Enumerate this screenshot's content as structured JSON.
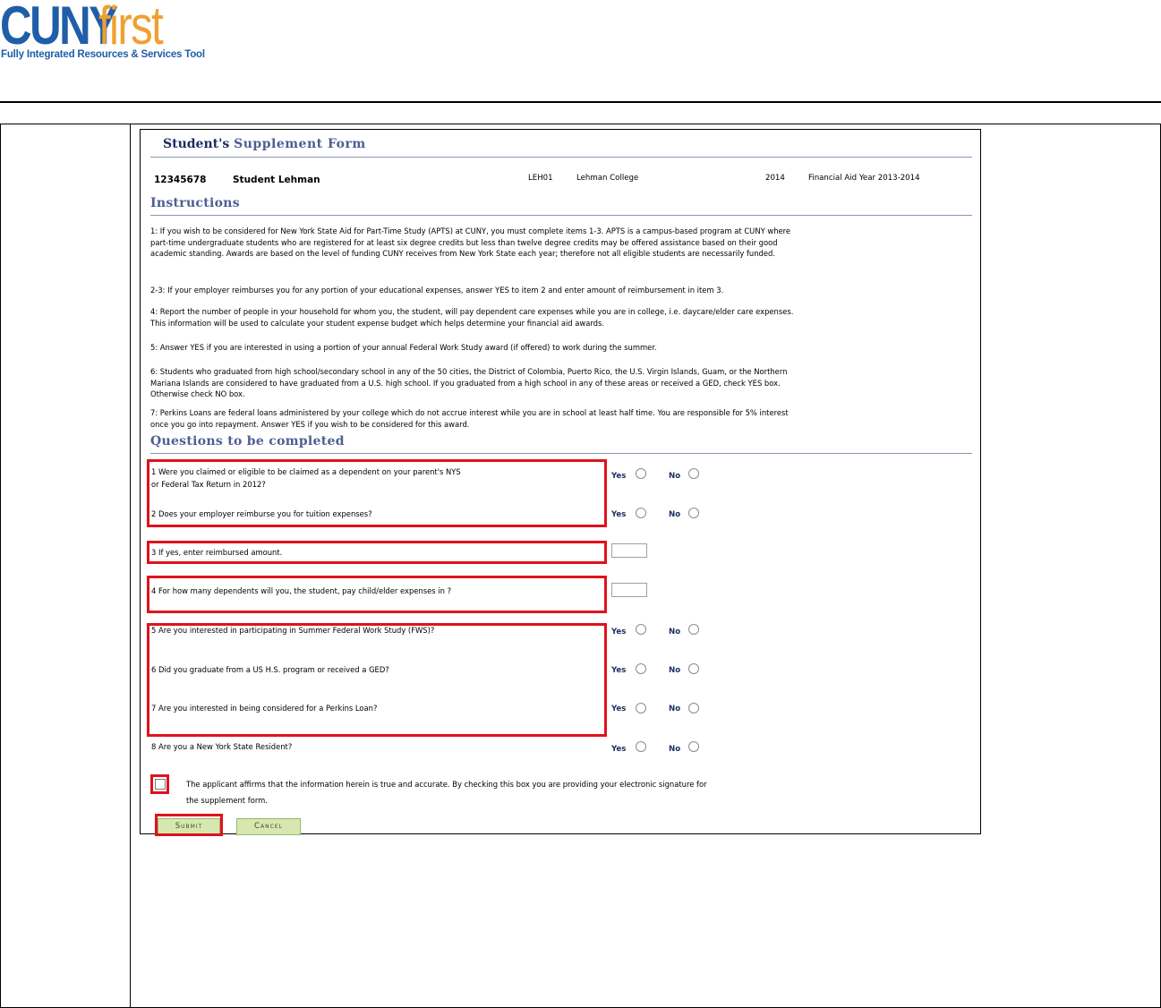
{
  "logo": {
    "brand_main": "CUNY",
    "brand_accent": "first",
    "tagline": "Fully Integrated Resources & Services Tool",
    "colors": {
      "blue": "#1f5ea8",
      "orange": "#f0a030"
    }
  },
  "form": {
    "title_part1": "Student's",
    "title_part2": "Supplement Form",
    "student_id": "12345678",
    "student_name": "Student Lehman",
    "institution_code": "LEH01",
    "institution_name": "Lehman College",
    "aid_year": "2014",
    "aid_year_desc": "Financial Aid Year 2013-2014",
    "instructions_heading": "Instructions",
    "instructions": [
      "1: If you wish to be considered for New York State Aid for Part-Time Study (APTS) at CUNY, you must complete items 1-3. APTS is a campus-based program at CUNY where part-time undergraduate students who are registered for at least six degree credits but less than twelve degree credits may be offered assistance based on their good academic standing. Awards are based on the level of funding CUNY receives from New York State each year; therefore not all eligible students are necessarily funded.",
      "2-3: If your employer reimburses you for any portion of your educational expenses, answer YES to item 2 and enter amount of reimbursement in item 3.",
      "4: Report the number of people in your household for whom you, the student, will pay dependent care expenses while you are in college, i.e. daycare/elder care expenses. This information will be used to calculate your student expense budget which helps determine your financial aid awards.",
      "5: Answer YES if you are interested in using a portion of your annual Federal Work Study award (if offered) to work during the summer.",
      "6: Students who graduated from high school/secondary school in any of the 50 cities, the District of Colombia, Puerto Rico, the U.S. Virgin Islands, Guam, or the Northern Mariana Islands are considered to have graduated from a U.S. high school. If you graduated from a high school in any of these areas or received a GED, check YES box. Otherwise check NO box.",
      "7: Perkins Loans are federal loans administered by your college which do not accrue interest while you are in school at least half time. You are responsible for 5% interest once you go into repayment. Answer YES if you wish to be considered for this award."
    ],
    "questions_heading": "Questions to be completed",
    "q1_line1": "1 Were you claimed or eligible to be claimed as a dependent on your parent's NYS",
    "q1_line2": "or Federal Tax Return in 2012?",
    "q2": "2 Does your employer reimburse you for tuition expenses?",
    "q3": "3 If yes, enter reimbursed amount.",
    "q4": "4 For how many dependents will you, the student, pay child/elder expenses in ?",
    "q5": "5 Are you interested in participating in Summer Federal Work Study (FWS)?",
    "q6": "6 Did you graduate from a US H.S. program or received a GED?",
    "q7": "7 Are you interested in being considered for a Perkins Loan?",
    "q8": "8 Are you a New York State Resident?",
    "yes_label": "Yes",
    "no_label": "No",
    "q3_value": "",
    "q4_value": "",
    "affirm_line1": "The applicant affirms that the information herein is true and accurate. By checking this box you are providing your electronic signature for",
    "affirm_line2": "the supplement form.",
    "submit_label": "Submit",
    "cancel_label": "Cancel",
    "highlight_color": "#e0121c"
  }
}
